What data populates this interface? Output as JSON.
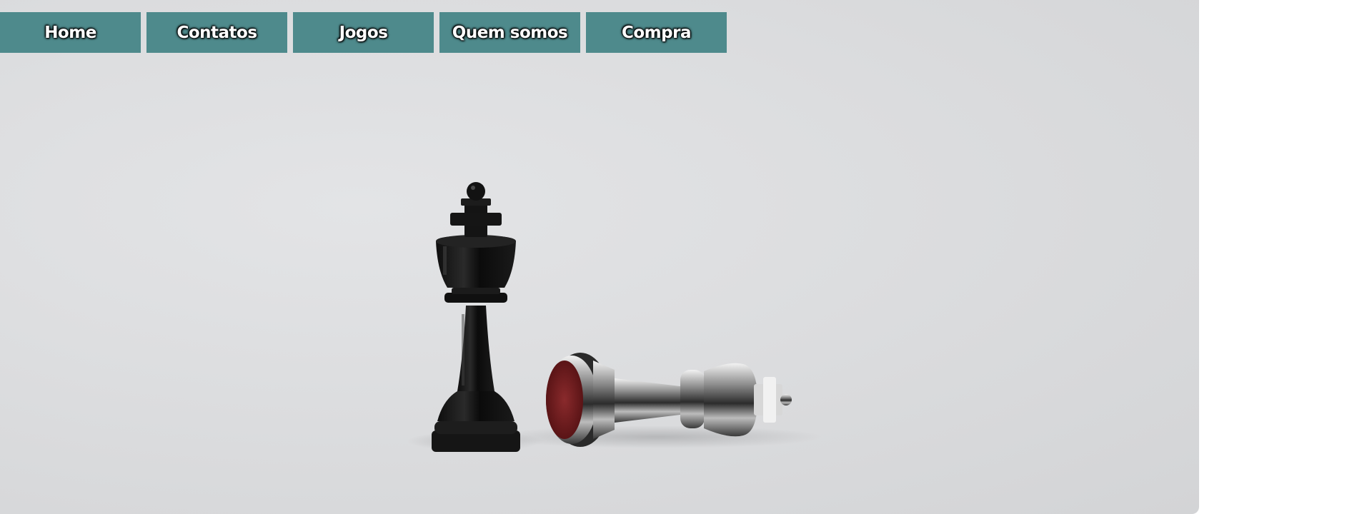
{
  "nav": {
    "items": [
      {
        "label": "Home"
      },
      {
        "label": "Contatos"
      },
      {
        "label": "Jogos"
      },
      {
        "label": "Quem somos"
      },
      {
        "label": "Compra"
      }
    ]
  },
  "hero": {
    "image": "chess-kings-photo",
    "colors": {
      "nav_background": "#4e8a8c",
      "nav_text": "#ffffff",
      "background": "#dcdddf"
    }
  }
}
